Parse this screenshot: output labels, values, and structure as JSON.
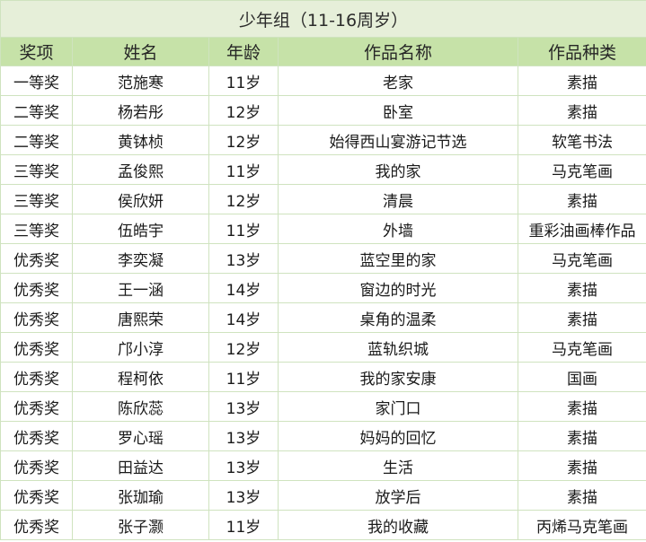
{
  "title": "少年组（11-16周岁）",
  "columns": [
    "奖项",
    "姓名",
    "年龄",
    "作品名称",
    "作品种类"
  ],
  "rows": [
    [
      "一等奖",
      "范施寒",
      "11岁",
      "老家",
      "素描"
    ],
    [
      "二等奖",
      "杨若彤",
      "12岁",
      "卧室",
      "素描"
    ],
    [
      "二等奖",
      "黄钵桢",
      "12岁",
      "始得西山宴游记节选",
      "软笔书法"
    ],
    [
      "三等奖",
      "孟俊熙",
      "11岁",
      "我的家",
      "马克笔画"
    ],
    [
      "三等奖",
      "侯欣妍",
      "12岁",
      "清晨",
      "素描"
    ],
    [
      "三等奖",
      "伍皓宇",
      "11岁",
      "外墙",
      "重彩油画棒作品"
    ],
    [
      "优秀奖",
      "李奕凝",
      "13岁",
      "蓝空里的家",
      "马克笔画"
    ],
    [
      "优秀奖",
      "王一涵",
      "14岁",
      "窗边的时光",
      "素描"
    ],
    [
      "优秀奖",
      "唐熙荣",
      "14岁",
      "桌角的温柔",
      "素描"
    ],
    [
      "优秀奖",
      "邝小淳",
      "12岁",
      "蓝轨织城",
      "马克笔画"
    ],
    [
      "优秀奖",
      "程柯依",
      "11岁",
      "我的家安康",
      "国画"
    ],
    [
      "优秀奖",
      "陈欣蕊",
      "13岁",
      "家门口",
      "素描"
    ],
    [
      "优秀奖",
      "罗心瑶",
      "13岁",
      "妈妈的回忆",
      "素描"
    ],
    [
      "优秀奖",
      "田益达",
      "13岁",
      "生活",
      "素描"
    ],
    [
      "优秀奖",
      "张珈瑜",
      "13岁",
      "放学后",
      "素描"
    ],
    [
      "优秀奖",
      "张子灏",
      "11岁",
      "我的收藏",
      "丙烯马克笔画"
    ]
  ],
  "colors": {
    "title_bg": "#e6efd9",
    "header_bg": "#c6e2a8",
    "border": "#cfe3bf"
  }
}
